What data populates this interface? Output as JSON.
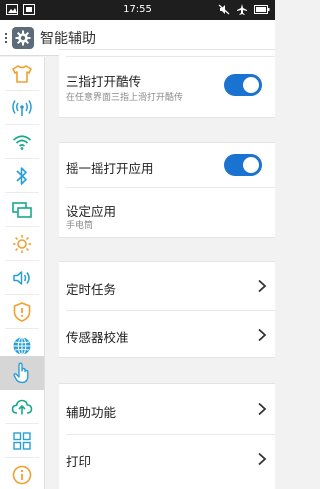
{
  "status_bar": {
    "time": "17:55",
    "left_icons": [
      "gallery-icon",
      "screenshot-icon"
    ],
    "right_icons": [
      "mute-icon",
      "airplane-icon",
      "battery-icon"
    ]
  },
  "header": {
    "title": "智能辅助",
    "app_icon": "gear-icon"
  },
  "sidebar": {
    "items": [
      {
        "icon": "shirt-icon",
        "active": false
      },
      {
        "icon": "antenna-icon",
        "active": false
      },
      {
        "icon": "wifi-icon",
        "active": false
      },
      {
        "icon": "bluetooth-icon",
        "active": false
      },
      {
        "icon": "screens-icon",
        "active": false
      },
      {
        "icon": "brightness-icon",
        "active": false
      },
      {
        "icon": "volume-icon",
        "active": false
      },
      {
        "icon": "shield-icon",
        "active": false
      },
      {
        "icon": "globe-icon",
        "active": false
      },
      {
        "icon": "hand-icon",
        "active": true
      },
      {
        "icon": "cloud-upload-icon",
        "active": false
      },
      {
        "icon": "grid-icon",
        "active": false
      },
      {
        "icon": "info-icon",
        "active": false
      }
    ]
  },
  "settings": {
    "three_finger": {
      "label": "三指打开酷传",
      "subtitle": "在任意界面三指上滑打开酷传",
      "enabled": true
    },
    "shake_open": {
      "label": "摇一摇打开应用",
      "enabled": true
    },
    "set_app": {
      "label": "设定应用",
      "value": "手电筒"
    },
    "scheduled_tasks": {
      "label": "定时任务"
    },
    "sensor_calibration": {
      "label": "传感器校准"
    },
    "accessibility": {
      "label": "辅助功能"
    },
    "print": {
      "label": "打印"
    }
  },
  "colors": {
    "accent": "#1b73d1",
    "sidebar_icon": "#2a9fd6",
    "sidebar_icon_orange": "#f0a030"
  }
}
